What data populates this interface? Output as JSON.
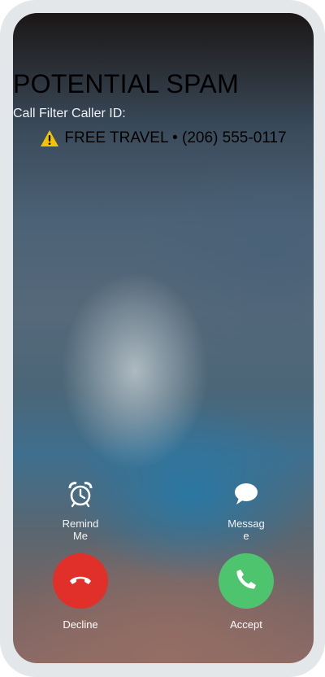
{
  "call": {
    "title": "POTENTIAL SPAM",
    "subtitle": "Call Filter Caller ID:",
    "caller_id": "FREE TRAVEL • (206) 555-0117",
    "warning_icon": "warning-icon"
  },
  "actions": {
    "remind_label": "Remind Me",
    "remind_icon": "alarm-clock-icon",
    "message_label": "Message",
    "message_icon": "message-bubble-icon",
    "decline_label": "Decline",
    "decline_icon": "phone-hangup-icon",
    "accept_label": "Accept",
    "accept_icon": "phone-icon"
  },
  "colors": {
    "decline": "#e03029",
    "accept": "#4fc46f",
    "warning": "#f5c400",
    "frame": "#e4e7e9"
  }
}
